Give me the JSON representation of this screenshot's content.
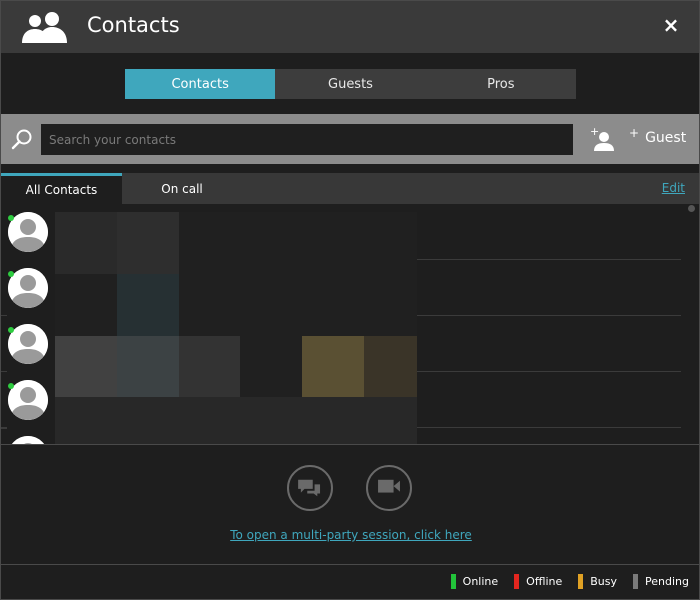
{
  "header": {
    "title": "Contacts",
    "close_label": "×"
  },
  "segments": [
    {
      "label": "Contacts",
      "active": true
    },
    {
      "label": "Guests",
      "active": false
    },
    {
      "label": "Pros",
      "active": false
    }
  ],
  "search": {
    "placeholder": "Search your contacts"
  },
  "actions": {
    "add_guest_label": "Guest",
    "add_guest_plus": "+"
  },
  "subtabs": [
    {
      "label": "All Contacts",
      "active": true
    },
    {
      "label": "On call",
      "active": false
    }
  ],
  "edit_label": "Edit",
  "contacts": [
    {
      "status": "online"
    },
    {
      "status": "online"
    },
    {
      "status": "online"
    },
    {
      "status": "online"
    },
    {
      "status": "unknown"
    }
  ],
  "multi_party_link": "To open a multi-party session, click here",
  "legend": [
    {
      "label": "Online",
      "color": "#22c33a"
    },
    {
      "label": "Offline",
      "color": "#e3261f"
    },
    {
      "label": "Busy",
      "color": "#e0a124"
    },
    {
      "label": "Pending",
      "color": "#7a7a7a"
    }
  ],
  "colors": {
    "accent": "#3fa7bd",
    "online": "#2ecc40"
  }
}
